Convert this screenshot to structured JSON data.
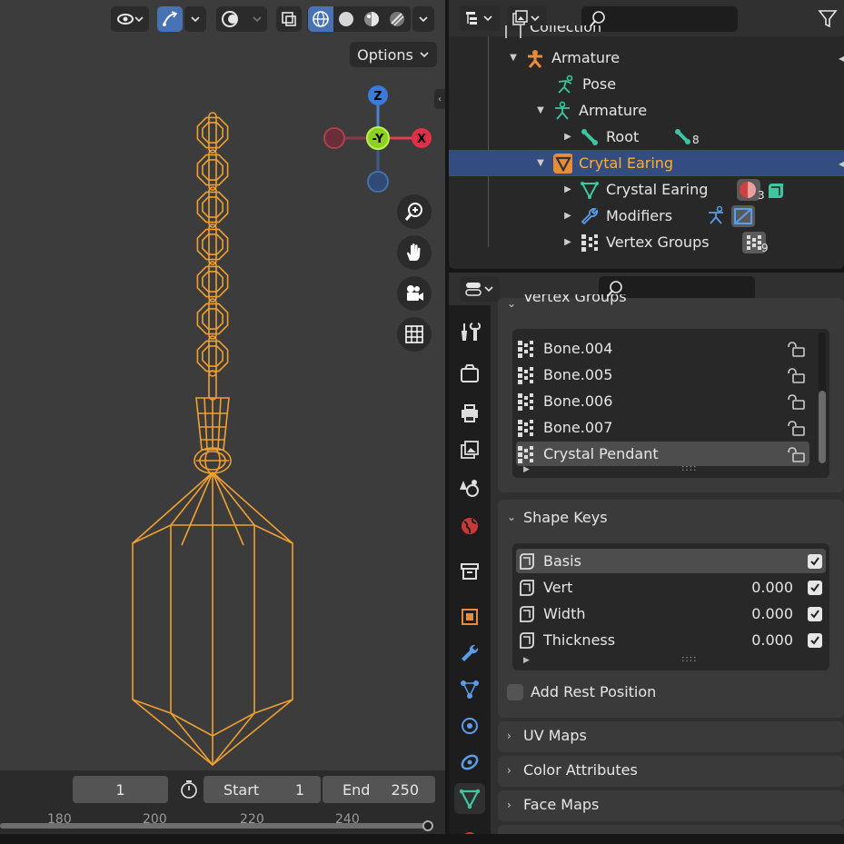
{
  "viewport": {
    "options_label": "Options",
    "gizmo": {
      "z": "Z",
      "neg_y": "-Y",
      "x": "X"
    }
  },
  "timeline": {
    "current_frame": "1",
    "start_label": "Start",
    "start_value": "1",
    "end_label": "End",
    "end_value": "250",
    "ruler": [
      "180",
      "200",
      "220",
      "240"
    ]
  },
  "outliner": {
    "rows": [
      {
        "label": "Collection",
        "indent": 0
      },
      {
        "label": "Armature"
      },
      {
        "label": "Pose"
      },
      {
        "label": "Armature"
      },
      {
        "label": "Root",
        "badge": "8"
      },
      {
        "label": "Crytal Earing"
      },
      {
        "label": "Crystal Earing",
        "badge": "3"
      },
      {
        "label": "Modifiers"
      },
      {
        "label": "Vertex Groups",
        "badge": "9"
      }
    ]
  },
  "properties": {
    "vertex_groups": {
      "title": "Vertex Groups",
      "items": [
        "Bone.004",
        "Bone.005",
        "Bone.006",
        "Bone.007",
        "Crystal Pendant"
      ]
    },
    "shape_keys": {
      "title": "Shape Keys",
      "items": [
        {
          "name": "Basis",
          "value": ""
        },
        {
          "name": "Vert",
          "value": "0.000"
        },
        {
          "name": "Width",
          "value": "0.000"
        },
        {
          "name": "Thickness",
          "value": "0.000"
        }
      ],
      "add_rest_position": "Add Rest Position"
    },
    "collapsed_panels": [
      "UV Maps",
      "Color Attributes",
      "Face Maps"
    ]
  },
  "colors": {
    "accent": "#4772b3",
    "selected_row": "#334d80",
    "selected_text": "#ffaf29",
    "wire": "#f0a030"
  }
}
